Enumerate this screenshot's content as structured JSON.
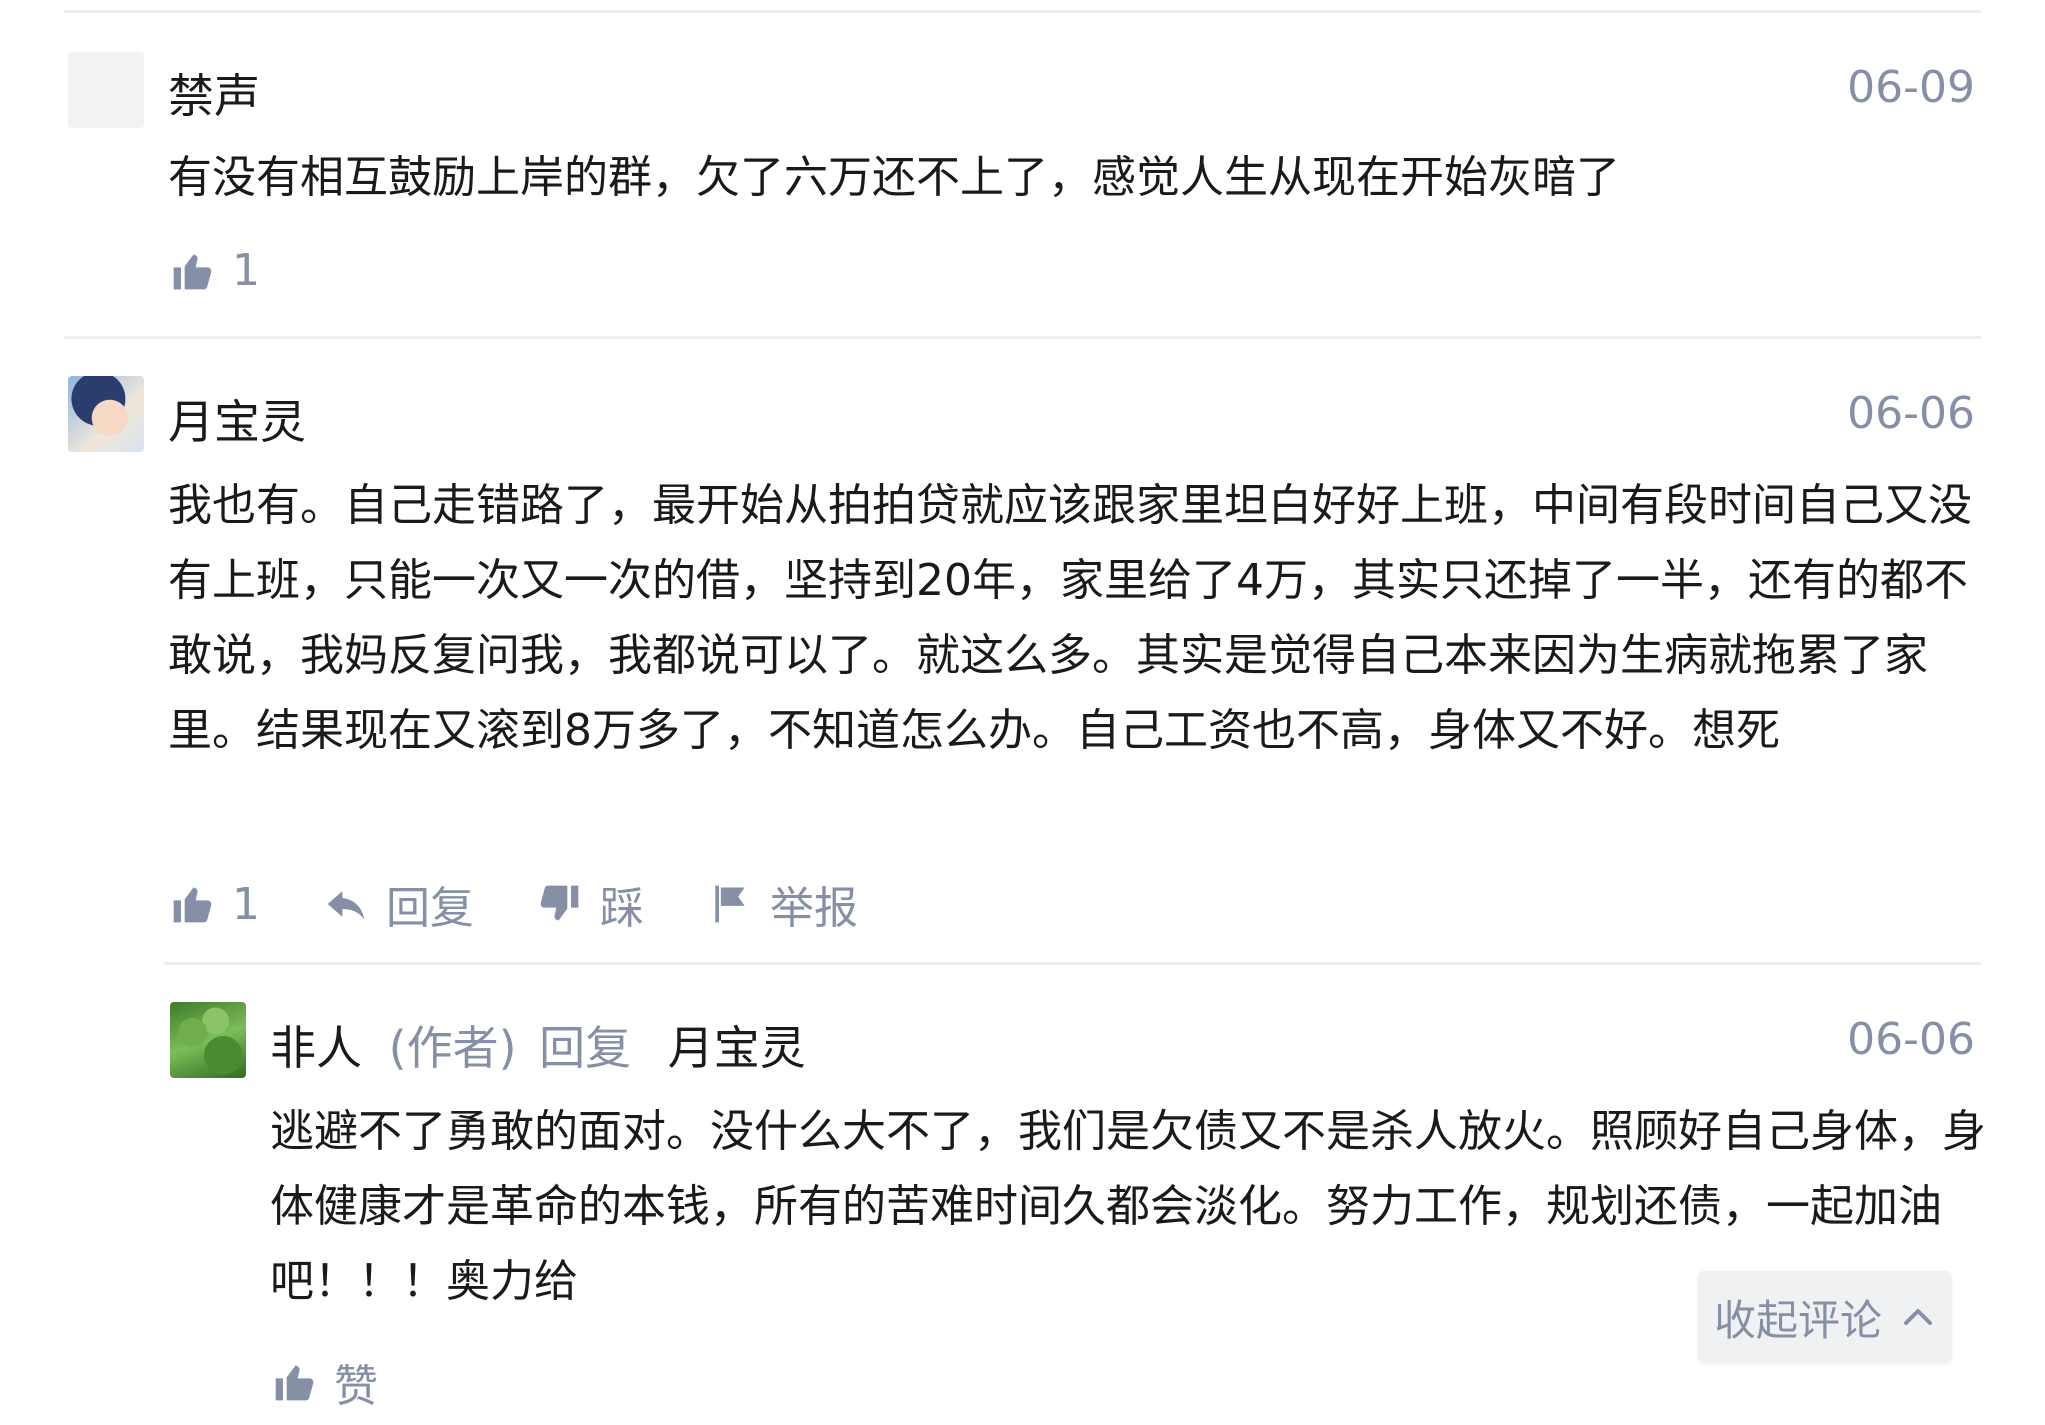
{
  "comments": [
    {
      "username": "禁声",
      "date": "06-09",
      "text": "有没有相互鼓励上岸的群，欠了六万还不上了，感觉人生从现在开始灰暗了",
      "like_count": "1"
    },
    {
      "username": "月宝灵",
      "date": "06-06",
      "text": "我也有。自己走错路了，最开始从拍拍贷就应该跟家里坦白好好上班，中间有段时间自己又没有上班，只能一次又一次的借，坚持到20年，家里给了4万，其实只还掉了一半，还有的都不敢说，我妈反复问我，我都说可以了。就这么多。其实是觉得自己本来因为生病就拖累了家里。结果现在又滚到8万多了，不知道怎么办。自己工资也不高，身体又不好。想死",
      "like_count": "1",
      "reply_label": "回复",
      "dislike_label": "踩",
      "report_label": "举报"
    }
  ],
  "reply": {
    "username": "非人",
    "author_tag": "(作者)",
    "reply_word": "回复",
    "reply_to": "月宝灵",
    "date": "06-06",
    "text": "逃避不了勇敢的面对。没什么大不了，我们是欠债又不是杀人放火。照顾好自己身体，身体健康才是革命的本钱，所有的苦难时间久都会淡化。努力工作，规划还债，一起加油吧！！！奥力给",
    "like_label": "赞"
  },
  "collapse_label": "收起评论",
  "colors": {
    "text": "#1a1a1a",
    "meta": "#8590a6",
    "divider": "#eeeef1",
    "button_bg": "#f0f1f3"
  }
}
